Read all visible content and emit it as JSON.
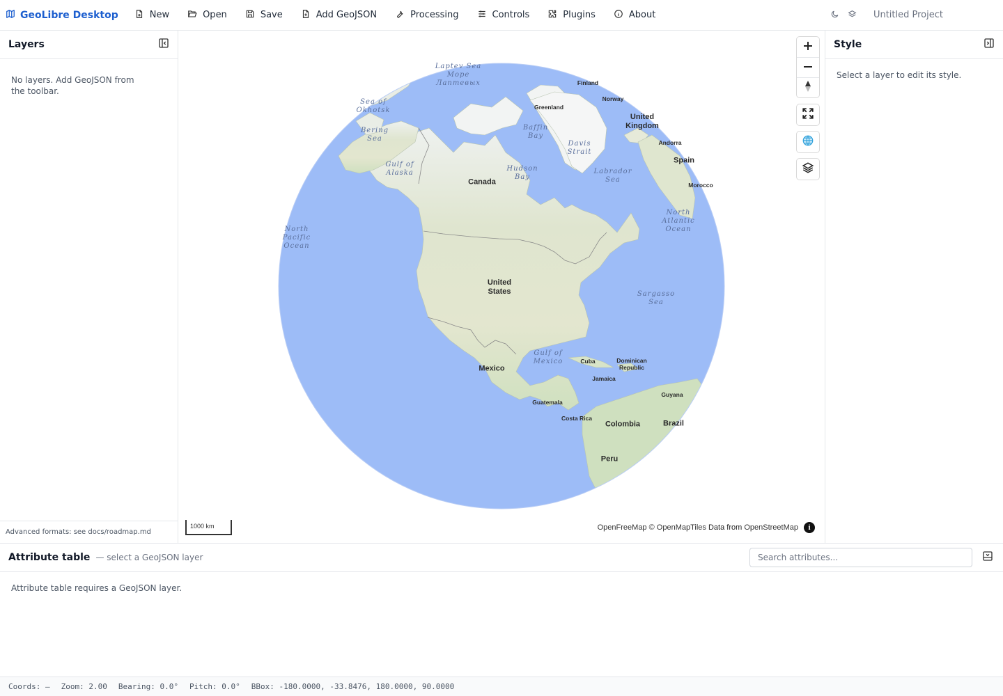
{
  "app": {
    "name": "GeoLibre Desktop",
    "project": "Untitled Project"
  },
  "toolbar": {
    "items": [
      {
        "label": "New",
        "icon": "new-file-icon"
      },
      {
        "label": "Open",
        "icon": "folder-open-icon"
      },
      {
        "label": "Save",
        "icon": "save-icon"
      },
      {
        "label": "Add GeoJSON",
        "icon": "file-plus-icon"
      },
      {
        "label": "Processing",
        "icon": "wrench-icon"
      },
      {
        "label": "Controls",
        "icon": "sliders-icon"
      },
      {
        "label": "Plugins",
        "icon": "puzzle-icon"
      },
      {
        "label": "About",
        "icon": "info-icon"
      }
    ]
  },
  "layers_panel": {
    "title": "Layers",
    "empty": "No layers. Add GeoJSON from the toolbar.",
    "footer": "Advanced formats: see docs/roadmap.md"
  },
  "style_panel": {
    "title": "Style",
    "empty": "Select a layer to edit its style."
  },
  "map": {
    "ocean_color": "#9dbcf7",
    "scale": "1000 km",
    "attribution": {
      "a": "OpenFreeMap",
      "b": "© OpenMapTiles",
      "c": "Data from",
      "d": "OpenStreetMap"
    },
    "ocean_labels": {
      "laptev": "Laptev Sea\nМоре\nЛаптевых",
      "okhotsk": "Sea of\nOkhotsk",
      "bering": "Bering\nSea",
      "alaska": "Gulf of\nAlaska",
      "baffin": "Baffin\nBay",
      "davis": "Davis\nStrait",
      "hudson": "Hudson\nBay",
      "labrador": "Labrador\nSea",
      "north_atlantic": "North\nAtlantic\nOcean",
      "north_pacific": "North\nPacific\nOcean",
      "sargasso": "Sargasso\nSea",
      "mexico_gulf": "Gulf of\nMexico"
    },
    "country_labels": {
      "canada": "Canada",
      "us": "United\nStates",
      "mexico": "Mexico",
      "colombia": "Colombia",
      "brazil": "Brazil",
      "peru": "Peru",
      "uk": "United\nKingdom",
      "spain": "Spain",
      "finland": "Finland",
      "norway": "Norway",
      "greenland": "Greenland",
      "andorra": "Andorra",
      "morocco": "Morocco",
      "cuba": "Cuba",
      "dominican": "Dominican\nRepublic",
      "jamaica": "Jamaica",
      "guatemala": "Guatemala",
      "costa_rica": "Costa Rica",
      "guyana": "Guyana"
    }
  },
  "attribute_table": {
    "title": "Attribute table",
    "subtitle": "— select a GeoJSON layer",
    "search_placeholder": "Search attributes...",
    "empty": "Attribute table requires a GeoJSON layer."
  },
  "status": {
    "coords": "Coords: —",
    "zoom": "Zoom: 2.00",
    "bearing": "Bearing: 0.0°",
    "pitch": "Pitch: 0.0°",
    "bbox": "BBox: -180.0000, -33.8476, 180.0000, 90.0000"
  }
}
